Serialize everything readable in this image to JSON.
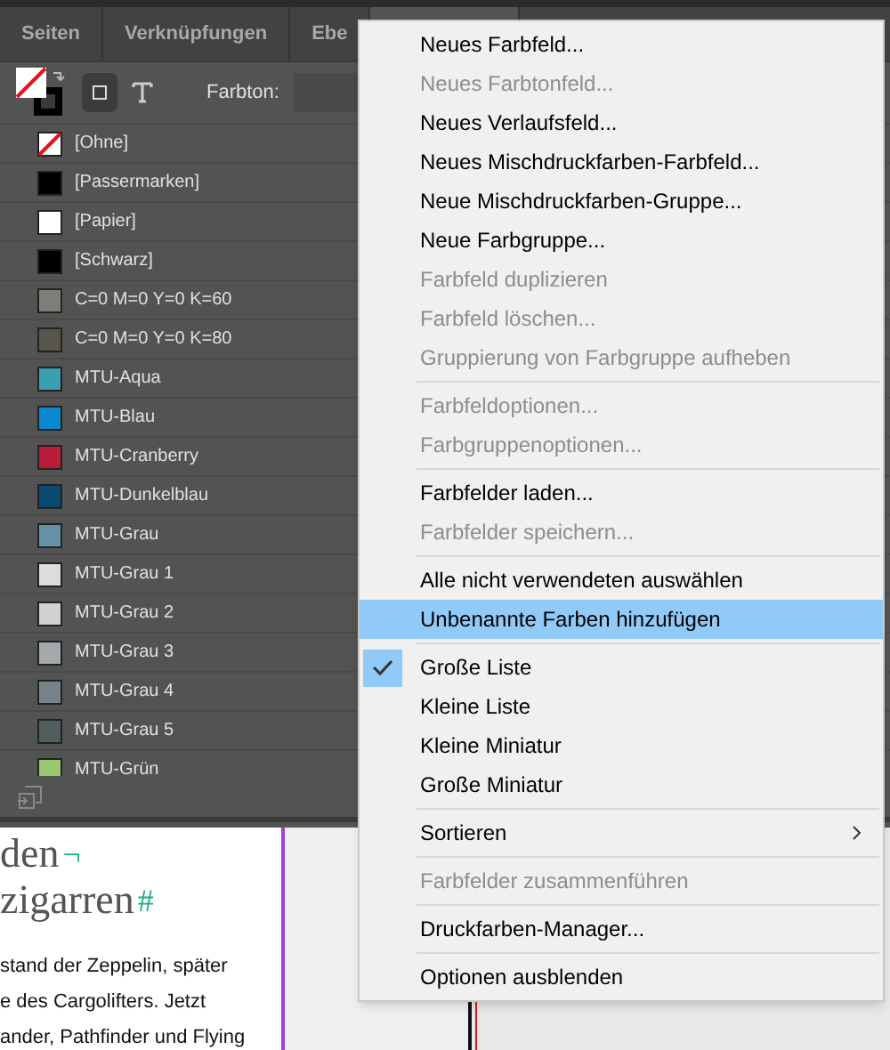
{
  "panel": {
    "tabs": [
      {
        "label": "Seiten",
        "selected": false
      },
      {
        "label": "Verknüpfungen",
        "selected": false
      },
      {
        "label": "Ebe",
        "selected": false
      },
      {
        "selected": true
      }
    ],
    "toolbar": {
      "tint_label": "Farbton:"
    },
    "swatches": [
      {
        "name": "[Ohne]",
        "kind": "none",
        "color": "#ffffff"
      },
      {
        "name": "[Passermarken]",
        "kind": "solid",
        "color": "#000000"
      },
      {
        "name": "[Papier]",
        "kind": "solid",
        "color": "#ffffff"
      },
      {
        "name": "[Schwarz]",
        "kind": "solid",
        "color": "#000000"
      },
      {
        "name": "C=0 M=0 Y=0 K=60",
        "kind": "solid",
        "color": "#7e7d78"
      },
      {
        "name": "C=0 M=0 Y=0 K=80",
        "kind": "solid",
        "color": "#58554d"
      },
      {
        "name": "MTU-Aqua",
        "kind": "solid",
        "color": "#3a9fb0"
      },
      {
        "name": "MTU-Blau",
        "kind": "solid",
        "color": "#0a88d0"
      },
      {
        "name": "MTU-Cranberry",
        "kind": "solid",
        "color": "#b91d3a"
      },
      {
        "name": "MTU-Dunkelblau",
        "kind": "solid",
        "color": "#0a4a70"
      },
      {
        "name": "MTU-Grau",
        "kind": "solid",
        "color": "#6690a8"
      },
      {
        "name": "MTU-Grau 1",
        "kind": "solid",
        "color": "#dcdcd8"
      },
      {
        "name": "MTU-Grau 2",
        "kind": "solid",
        "color": "#d0d2d0"
      },
      {
        "name": "MTU-Grau 3",
        "kind": "solid",
        "color": "#a4aaab"
      },
      {
        "name": "MTU-Grau 4",
        "kind": "solid",
        "color": "#77838a"
      },
      {
        "name": "MTU-Grau 5",
        "kind": "solid",
        "color": "#515e5e"
      },
      {
        "name": "MTU-Grün",
        "kind": "solid",
        "color": "#9ac870"
      }
    ]
  },
  "document": {
    "heading": [
      {
        "text": "den",
        "mark": "¬"
      },
      {
        "text": "zigarren",
        "mark": "#"
      }
    ],
    "body": [
      "stand der Zeppelin, später",
      "e des Cargolifters. Jetzt",
      "ander, Pathfinder und Flying"
    ]
  },
  "menu": [
    {
      "kind": "item",
      "label": "Neues Farbfeld...",
      "disabled": false,
      "selected": false,
      "checked": false,
      "submenu": false
    },
    {
      "kind": "item",
      "label": "Neues Farbtonfeld...",
      "disabled": true,
      "selected": false,
      "checked": false,
      "submenu": false
    },
    {
      "kind": "item",
      "label": "Neues Verlaufsfeld...",
      "disabled": false,
      "selected": false,
      "checked": false,
      "submenu": false
    },
    {
      "kind": "item",
      "label": "Neues Mischdruckfarben-Farbfeld...",
      "disabled": false,
      "selected": false,
      "checked": false,
      "submenu": false
    },
    {
      "kind": "item",
      "label": "Neue Mischdruckfarben-Gruppe...",
      "disabled": false,
      "selected": false,
      "checked": false,
      "submenu": false
    },
    {
      "kind": "item",
      "label": "Neue Farbgruppe...",
      "disabled": false,
      "selected": false,
      "checked": false,
      "submenu": false
    },
    {
      "kind": "item",
      "label": "Farbfeld duplizieren",
      "disabled": true,
      "selected": false,
      "checked": false,
      "submenu": false
    },
    {
      "kind": "item",
      "label": "Farbfeld löschen...",
      "disabled": true,
      "selected": false,
      "checked": false,
      "submenu": false
    },
    {
      "kind": "item",
      "label": "Gruppierung von Farbgruppe aufheben",
      "disabled": true,
      "selected": false,
      "checked": false,
      "submenu": false
    },
    {
      "kind": "separator"
    },
    {
      "kind": "item",
      "label": "Farbfeldoptionen...",
      "disabled": true,
      "selected": false,
      "checked": false,
      "submenu": false
    },
    {
      "kind": "item",
      "label": "Farbgruppenoptionen...",
      "disabled": true,
      "selected": false,
      "checked": false,
      "submenu": false
    },
    {
      "kind": "separator"
    },
    {
      "kind": "item",
      "label": "Farbfelder laden...",
      "disabled": false,
      "selected": false,
      "checked": false,
      "submenu": false
    },
    {
      "kind": "item",
      "label": "Farbfelder speichern...",
      "disabled": true,
      "selected": false,
      "checked": false,
      "submenu": false
    },
    {
      "kind": "separator"
    },
    {
      "kind": "item",
      "label": "Alle nicht verwendeten auswählen",
      "disabled": false,
      "selected": false,
      "checked": false,
      "submenu": false
    },
    {
      "kind": "item",
      "label": "Unbenannte Farben hinzufügen",
      "disabled": false,
      "selected": true,
      "checked": false,
      "submenu": false
    },
    {
      "kind": "separator"
    },
    {
      "kind": "item",
      "label": "Große Liste",
      "disabled": false,
      "selected": false,
      "checked": true,
      "submenu": false
    },
    {
      "kind": "item",
      "label": "Kleine Liste",
      "disabled": false,
      "selected": false,
      "checked": false,
      "submenu": false
    },
    {
      "kind": "item",
      "label": "Kleine Miniatur",
      "disabled": false,
      "selected": false,
      "checked": false,
      "submenu": false
    },
    {
      "kind": "item",
      "label": "Große Miniatur",
      "disabled": false,
      "selected": false,
      "checked": false,
      "submenu": false
    },
    {
      "kind": "separator"
    },
    {
      "kind": "item",
      "label": "Sortieren",
      "disabled": false,
      "selected": false,
      "checked": false,
      "submenu": true
    },
    {
      "kind": "separator"
    },
    {
      "kind": "item",
      "label": "Farbfelder zusammenführen",
      "disabled": true,
      "selected": false,
      "checked": false,
      "submenu": false
    },
    {
      "kind": "separator"
    },
    {
      "kind": "item",
      "label": "Druckfarben-Manager...",
      "disabled": false,
      "selected": false,
      "checked": false,
      "submenu": false
    },
    {
      "kind": "separator"
    },
    {
      "kind": "item",
      "label": "Optionen ausblenden",
      "disabled": false,
      "selected": false,
      "checked": false,
      "submenu": false
    }
  ]
}
